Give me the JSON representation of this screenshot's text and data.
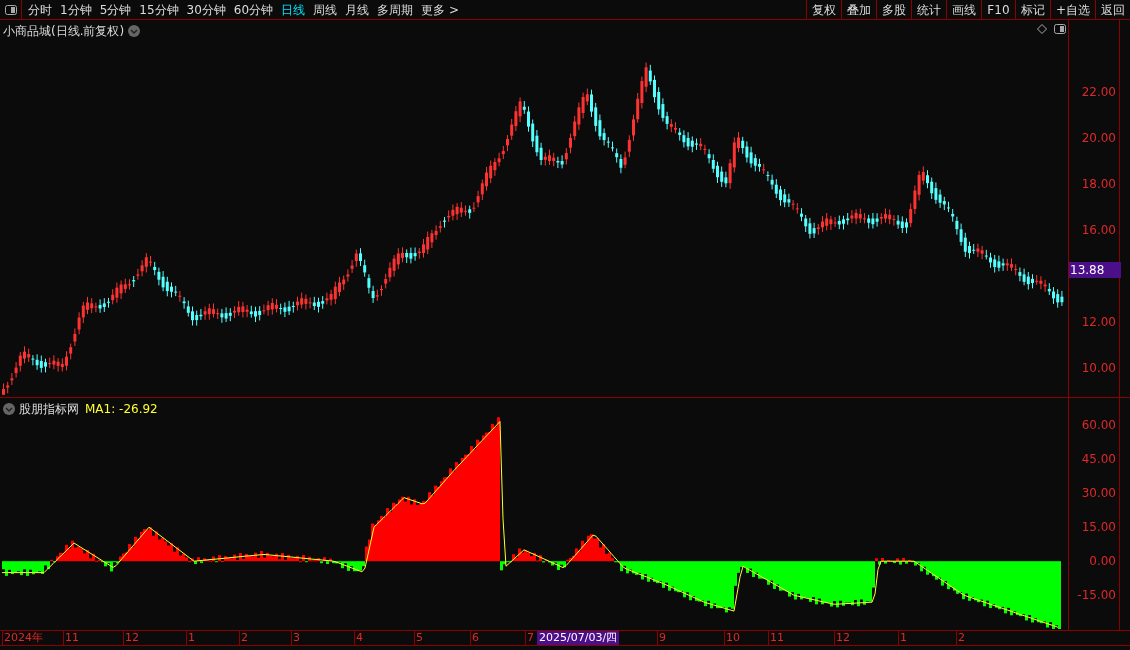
{
  "toolbar": {
    "periods": [
      {
        "label": "分时",
        "selected": false
      },
      {
        "label": "1分钟",
        "selected": false
      },
      {
        "label": "5分钟",
        "selected": false
      },
      {
        "label": "15分钟",
        "selected": false
      },
      {
        "label": "30分钟",
        "selected": false
      },
      {
        "label": "60分钟",
        "selected": false
      },
      {
        "label": "日线",
        "selected": true
      },
      {
        "label": "周线",
        "selected": false
      },
      {
        "label": "月线",
        "selected": false
      },
      {
        "label": "多周期",
        "selected": false
      }
    ],
    "more": "更多 >",
    "buttons": [
      "复权",
      "叠加",
      "多股",
      "统计",
      "画线",
      "F10",
      "标记",
      "+自选",
      "返回"
    ]
  },
  "main_chart": {
    "title": "小商品城(日线.前复权)",
    "price_ticks": [
      "22.00",
      "20.00",
      "18.00",
      "16.00",
      "12.00",
      "10.00"
    ],
    "current_price": "13.88"
  },
  "indicator": {
    "name": "股朋指标网",
    "ma_label": "MA1: -26.92",
    "ticks": [
      "60.00",
      "45.00",
      "30.00",
      "15.00",
      "0.00",
      "-15.00"
    ]
  },
  "x_axis": {
    "labels": [
      "2024年",
      "11",
      "12",
      "1",
      "2",
      "3",
      "4",
      "5",
      "6",
      "7",
      "9",
      "10",
      "11",
      "12",
      "1",
      "2"
    ],
    "cursor_date": "2025/07/03/四"
  }
}
